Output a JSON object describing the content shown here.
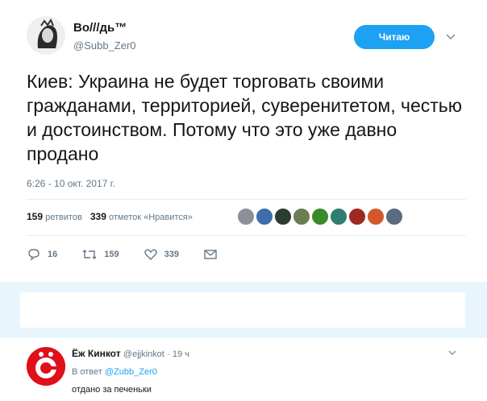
{
  "tweet": {
    "display_name": "Во///дь™",
    "username": "@Subb_Zer0",
    "follow_label": "Читаю",
    "text": "Киев: Украина не будет торговать своими гражданами, территорией, суверенитетом, честью и достоинством. Потому что это уже давно продано",
    "timestamp": "6:26 - 10 окт. 2017 г.",
    "retweets_count": "159",
    "retweets_label": "ретвитов",
    "likes_count": "339",
    "likes_label": "отметок «Нравится»",
    "likers": [
      "#8a8f99",
      "#3d6ea8",
      "#2a3d2f",
      "#6b7d52",
      "#3a8a2a",
      "#2f7d6f",
      "#9c2a22",
      "#d2582a",
      "#5a6b7d"
    ],
    "actions": {
      "reply_count": "16",
      "retweet_count": "159",
      "like_count": "339"
    }
  },
  "reply": {
    "name": "Ёж Кинкот",
    "username": "@ejjkinkot",
    "time": "· 19 ч",
    "in_reply_prefix": "В ответ",
    "in_reply_to": "@Zubb_Zer0",
    "text": "отдано за печеньки"
  }
}
